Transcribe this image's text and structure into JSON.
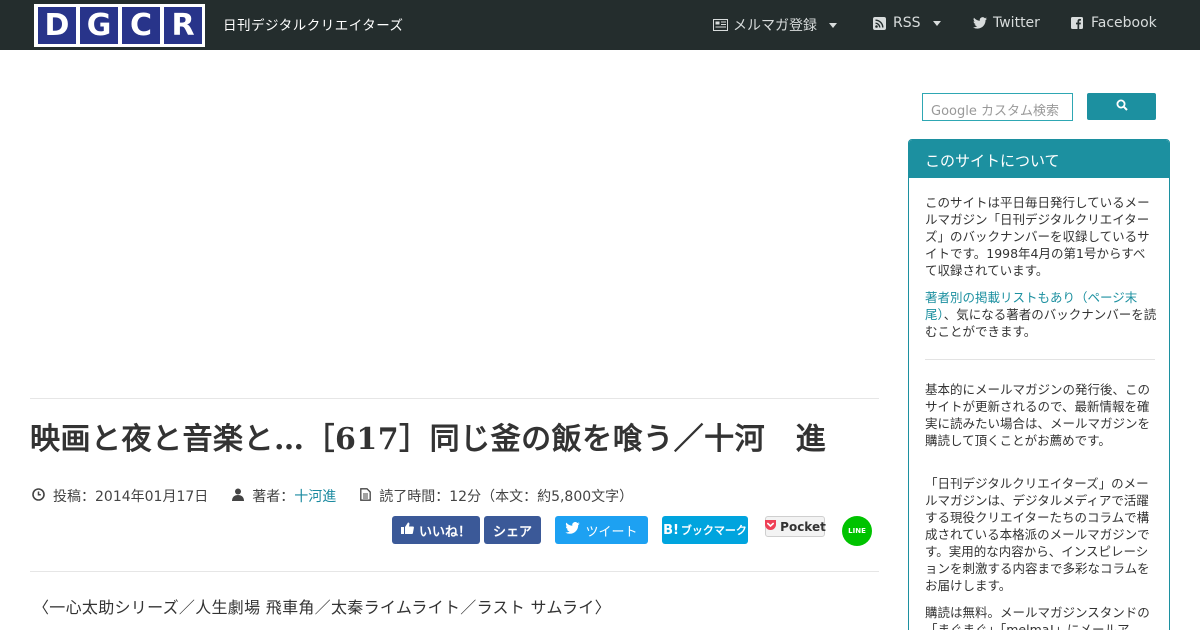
{
  "navbar": {
    "logo_letters": [
      "D",
      "G",
      "C",
      "R"
    ],
    "site_name": "日刊デジタルクリエイターズ",
    "items": [
      {
        "label": "メルマガ登録",
        "icon": "newspaper-icon",
        "has_dropdown": true
      },
      {
        "label": "RSS",
        "icon": "rss-icon",
        "has_dropdown": true
      },
      {
        "label": "Twitter",
        "icon": "twitter-icon",
        "has_dropdown": false
      },
      {
        "label": "Facebook",
        "icon": "facebook-icon",
        "has_dropdown": false
      }
    ]
  },
  "article": {
    "title": "映画と夜と音楽と…［617］同じ釜の飯を喰う／十河　進",
    "posted_label": "投稿：2014年01月17日",
    "author_prefix": "著者：",
    "author_name": "十河進",
    "read_time": "読了時間：12分（本文：約5,800文字）",
    "subtitle": "〈一心太助シリーズ／人生劇場 飛車角／太秦ライムライト／ラスト サムライ〉"
  },
  "share": {
    "like": "いいね！",
    "share": "シェア",
    "tweet": "ツイート",
    "hatena": "ブックマーク",
    "hatena_mark": "B!",
    "pocket": "Pocket",
    "line": "LINE"
  },
  "sidebar": {
    "search_placeholder": "Google カスタム検索",
    "panel_title": "このサイトについて",
    "para1": "このサイトは平日毎日発行しているメールマガジン「日刊デジタルクリエイターズ」のバックナンバーを収録しているサイトです。1998年4月の第1号からすべて収録されています。",
    "link": "著者別の掲載リストもあり（ページ末尾）",
    "para2_rest": "、気になる著者のバックナンバーを読むことができます。",
    "para3": "基本的にメールマガジンの発行後、このサイトが更新されるので、最新情報を確実に読みたい場合は、メールマガジンを購読して頂くことがお薦めです。",
    "para4": "「日刊デジタルクリエイターズ」のメールマガジンは、デジタルメディアで活躍する現役クリエイターたちのコラムで構成されている本格派のメールマガジンです。実用的な内容から、インスピレーションを刺激する内容まで多彩なコラムをお届けします。",
    "para5": "購読は無料。メールマガジンスタンドの「まぐまぐ」「melma!」にメールア"
  },
  "colors": {
    "navbar": "#242d2d",
    "logo_blue": "#28348a",
    "accent": "#1c90a0",
    "facebook": "#3b5998",
    "twitter": "#1da1f2",
    "hatena": "#00a4de",
    "line": "#00c300"
  }
}
